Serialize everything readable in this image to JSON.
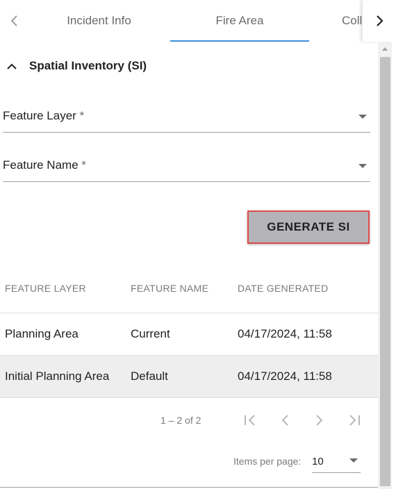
{
  "tabs": {
    "items": [
      {
        "label": "Incident Info"
      },
      {
        "label": "Fire Area"
      },
      {
        "label": "Coll"
      }
    ],
    "active_index": 1,
    "accent_color": "#3f8fdb"
  },
  "icons": {
    "tab_prev": "chevron-left-icon",
    "tab_next": "chevron-right-icon",
    "section_toggle": "chevron-up-icon",
    "dropdown": "caret-down-icon",
    "first_page": "first-page-icon",
    "prev_page": "chevron-left-icon",
    "next_page": "chevron-right-icon",
    "last_page": "last-page-icon"
  },
  "section": {
    "title": "Spatial Inventory (SI)"
  },
  "form": {
    "feature_layer_label": "Feature Layer",
    "feature_name_label": "Feature Name",
    "required_marker": "*"
  },
  "generate_button": {
    "label": "GENERATE SI",
    "highlight_color": "#e04b4b"
  },
  "table": {
    "headers": [
      "FEATURE LAYER",
      "FEATURE NAME",
      "DATE GENERATED"
    ],
    "rows": [
      [
        "Planning Area",
        "Current",
        "04/17/2024, 11:58"
      ],
      [
        "Initial Planning Area",
        "Default",
        "04/17/2024, 11:58"
      ]
    ]
  },
  "paginator": {
    "range_label": "1 – 2 of 2",
    "items_per_page_label": "Items per page:",
    "items_per_page_value": "10"
  }
}
